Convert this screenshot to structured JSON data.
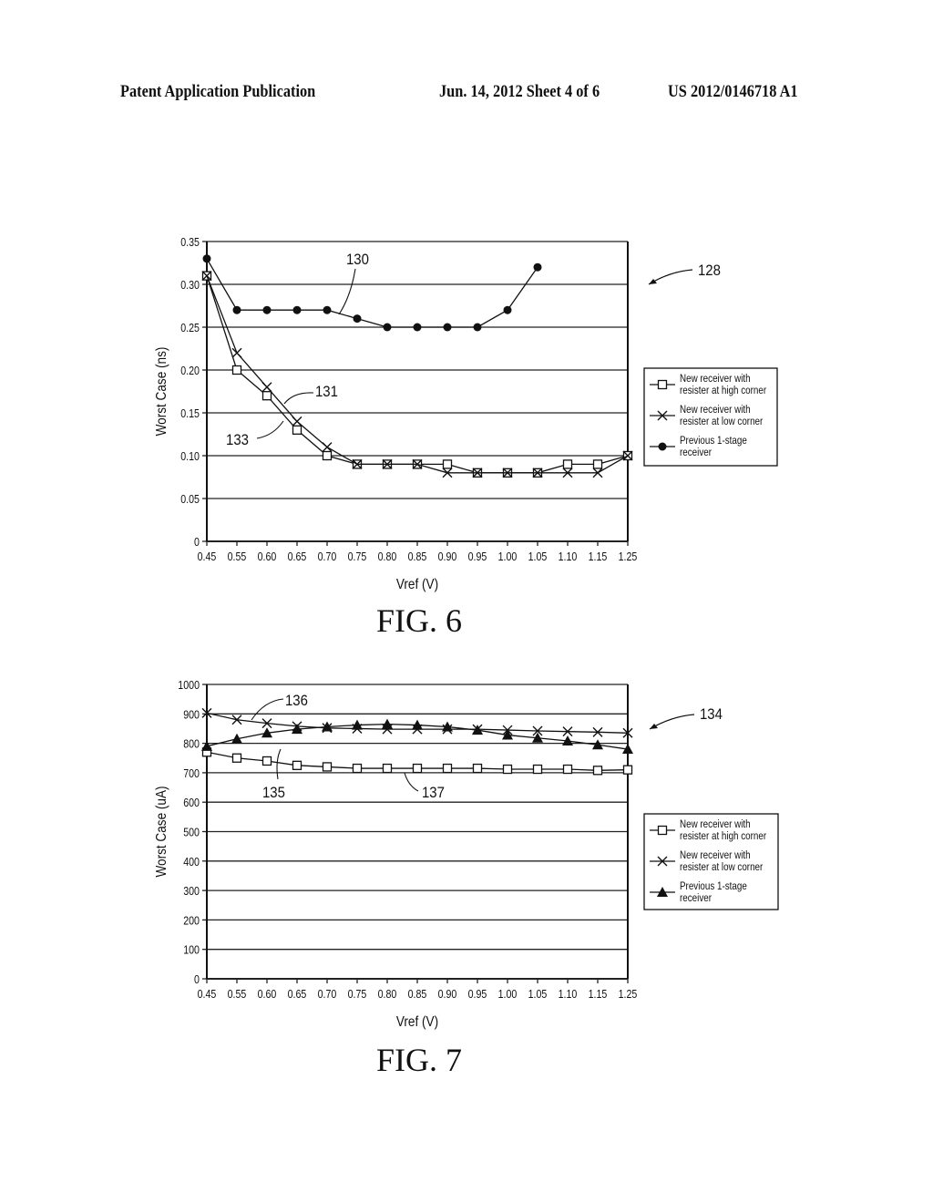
{
  "header": {
    "left": "Patent Application Publication",
    "middle": "Jun. 14, 2012  Sheet 4 of 6",
    "right": "US 2012/0146718 A1"
  },
  "chart_data": [
    {
      "type": "line",
      "figure_label": "FIG. 6",
      "reference_number": "128",
      "xlabel": "Vref (V)",
      "ylabel": "Worst Case (ns)",
      "x": [
        "0.45",
        "0.55",
        "0.60",
        "0.65",
        "0.70",
        "0.75",
        "0.80",
        "0.85",
        "0.90",
        "0.95",
        "1.00",
        "1.05",
        "1.10",
        "1.15",
        "1.25"
      ],
      "ylim": [
        0,
        0.35
      ],
      "yticks": [
        "0",
        "0.05",
        "0.10",
        "0.15",
        "0.20",
        "0.25",
        "0.30",
        "0.35"
      ],
      "grid": true,
      "legend_placement": "right",
      "series": [
        {
          "name": "New receiver with resister at high corner",
          "legend_lines": [
            "New receiver with",
            "resister at high corner"
          ],
          "marker": "square",
          "values": [
            0.31,
            0.2,
            0.17,
            0.13,
            0.1,
            0.09,
            0.09,
            0.09,
            0.09,
            0.08,
            0.08,
            0.08,
            0.09,
            0.09,
            0.1
          ]
        },
        {
          "name": "New receiver with resister at low corner",
          "legend_lines": [
            "New receiver with",
            "resister at low corner"
          ],
          "marker": "x",
          "values": [
            0.31,
            0.22,
            0.18,
            0.14,
            0.11,
            0.09,
            0.09,
            0.09,
            0.08,
            0.08,
            0.08,
            0.08,
            0.08,
            0.08,
            0.1
          ]
        },
        {
          "name": "Previous 1-stage receiver",
          "legend_lines": [
            "Previous 1-stage",
            "receiver"
          ],
          "marker": "circle",
          "values": [
            0.33,
            0.27,
            0.27,
            0.27,
            0.27,
            0.26,
            0.25,
            0.25,
            0.25,
            0.25,
            0.27,
            0.32,
            null,
            null,
            null
          ]
        }
      ],
      "annotations": [
        {
          "text": "130",
          "refers_to": "Previous 1-stage receiver"
        },
        {
          "text": "131",
          "refers_to": "New receiver with resister at low corner"
        },
        {
          "text": "133",
          "refers_to": "New receiver with resister at high corner"
        }
      ]
    },
    {
      "type": "line",
      "figure_label": "FIG. 7",
      "reference_number": "134",
      "xlabel": "Vref (V)",
      "ylabel": "Worst Case (uA)",
      "x": [
        "0.45",
        "0.55",
        "0.60",
        "0.65",
        "0.70",
        "0.75",
        "0.80",
        "0.85",
        "0.90",
        "0.95",
        "1.00",
        "1.05",
        "1.10",
        "1.15",
        "1.25"
      ],
      "ylim": [
        0,
        1000
      ],
      "yticks": [
        "0",
        "100",
        "200",
        "300",
        "400",
        "500",
        "600",
        "700",
        "800",
        "900",
        "1000"
      ],
      "grid": true,
      "legend_placement": "right",
      "series": [
        {
          "name": "New receiver with resister at high corner",
          "legend_lines": [
            "New receiver with",
            "resister at high corner"
          ],
          "marker": "square",
          "values": [
            770,
            750,
            740,
            725,
            720,
            715,
            715,
            715,
            715,
            715,
            712,
            712,
            712,
            708,
            710
          ]
        },
        {
          "name": "New receiver with resister at low corner",
          "legend_lines": [
            "New receiver with",
            "resister at low corner"
          ],
          "marker": "x",
          "values": [
            903,
            880,
            868,
            858,
            852,
            850,
            848,
            848,
            848,
            848,
            845,
            842,
            840,
            838,
            835
          ]
        },
        {
          "name": "Previous 1-stage receiver",
          "legend_lines": [
            "Previous 1-stage",
            "receiver"
          ],
          "marker": "triangle",
          "values": [
            790,
            815,
            835,
            848,
            856,
            862,
            865,
            862,
            856,
            845,
            828,
            818,
            808,
            795,
            780
          ]
        }
      ],
      "annotations": [
        {
          "text": "135",
          "refers_to": "Previous 1-stage receiver"
        },
        {
          "text": "136",
          "refers_to": "New receiver with resister at low corner"
        },
        {
          "text": "137",
          "refers_to": "New receiver with resister at high corner"
        }
      ]
    }
  ]
}
